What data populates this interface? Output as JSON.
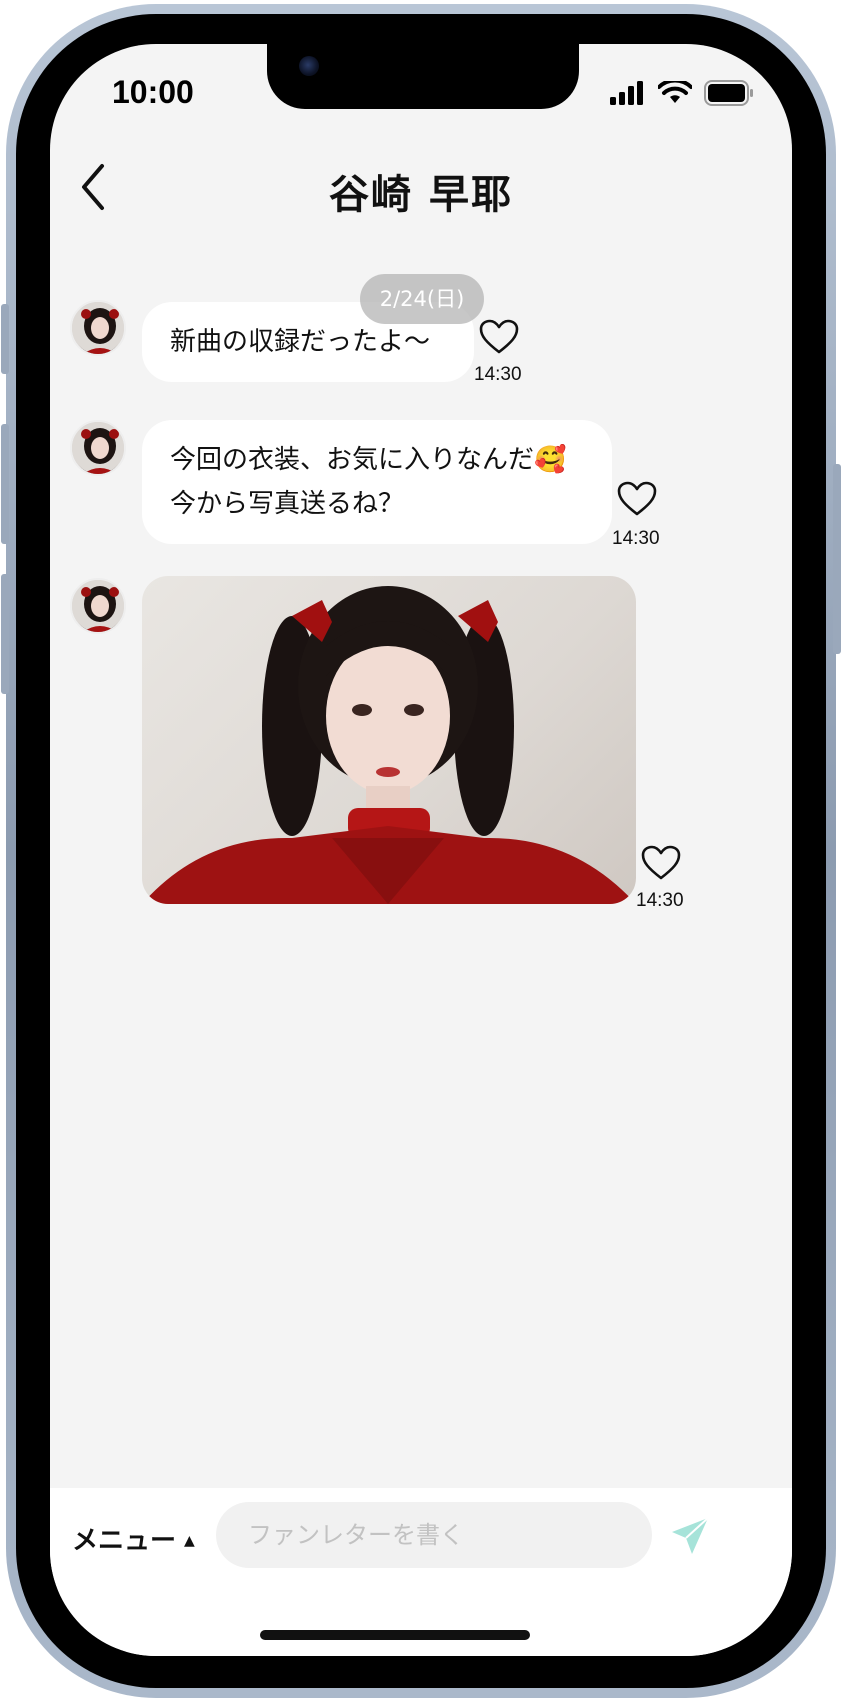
{
  "status_bar": {
    "time": "10:00"
  },
  "header": {
    "title": "谷崎 早耶"
  },
  "date_chip": "2/24(日)",
  "messages": [
    {
      "type": "text",
      "lines": [
        "新曲の収録だったよ〜"
      ],
      "time": "14:30"
    },
    {
      "type": "text",
      "lines": [
        "今回の衣装、お気に入りなんだ🥰",
        "今から写真送るね？"
      ],
      "time": "14:30"
    },
    {
      "type": "image",
      "time": "14:30"
    }
  ],
  "composer": {
    "menu_label": "メニュー",
    "menu_caret": "▲",
    "placeholder": "ファンレターを書く"
  },
  "colors": {
    "screen_bg": "#f4f4f4",
    "bubble_bg": "#ffffff",
    "send_accent": "#a6e3d9",
    "date_chip_bg": "#b4b4b4"
  },
  "icons": [
    "back-chevron-icon",
    "signal-icon",
    "wifi-icon",
    "battery-icon",
    "heart-icon",
    "send-icon"
  ]
}
